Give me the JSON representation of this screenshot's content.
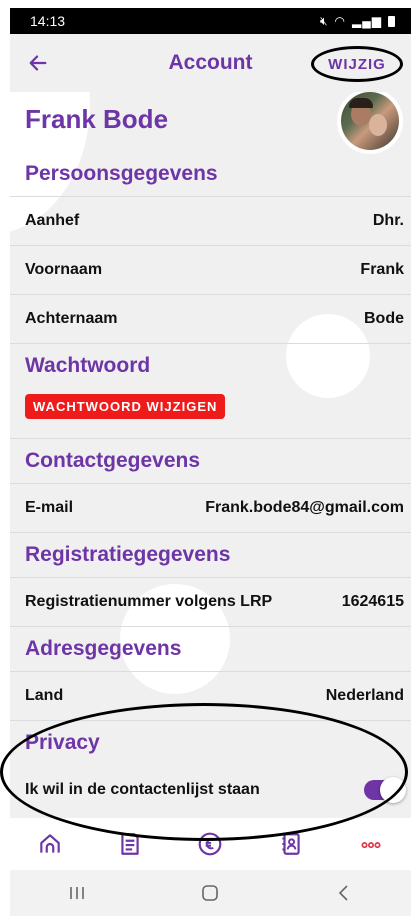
{
  "status_bar": {
    "time": "14:13",
    "icons": [
      "mute-icon",
      "wifi-icon",
      "signal-icon",
      "battery-icon"
    ]
  },
  "header": {
    "back_icon": "arrow-left-icon",
    "title": "Account",
    "edit_label": "WIJZIG"
  },
  "profile": {
    "name": "Frank Bode",
    "avatar": "profile-photo"
  },
  "sections": {
    "personal": {
      "title": "Persoonsgegevens",
      "rows": [
        {
          "label": "Aanhef",
          "value": "Dhr."
        },
        {
          "label": "Voornaam",
          "value": "Frank"
        },
        {
          "label": "Achternaam",
          "value": "Bode"
        }
      ]
    },
    "password": {
      "title": "Wachtwoord",
      "button_label": "WACHTWOORD WIJZIGEN"
    },
    "contact": {
      "title": "Contactgegevens",
      "rows": [
        {
          "label": "E-mail",
          "value": "Frank.bode84@gmail.com"
        }
      ]
    },
    "registration": {
      "title": "Registratiegegevens",
      "rows": [
        {
          "label": "Registratienummer volgens LRP",
          "value": "1624615"
        }
      ]
    },
    "address": {
      "title": "Adresgegevens",
      "rows": [
        {
          "label": "Land",
          "value": "Nederland"
        }
      ]
    },
    "privacy": {
      "title": "Privacy",
      "toggle_label": "Ik wil in de contactenlijst staan",
      "toggle_on": true
    }
  },
  "tab_bar": {
    "items": [
      "home-icon",
      "document-icon",
      "euro-icon",
      "contacts-icon",
      "more-icon"
    ]
  },
  "system_nav": {
    "items": [
      "recent-apps-button",
      "home-button",
      "back-button"
    ]
  },
  "colors": {
    "accent": "#6d35a6",
    "danger": "#ef1b1b",
    "more": "#e0394b",
    "background": "#f0f0f0"
  }
}
